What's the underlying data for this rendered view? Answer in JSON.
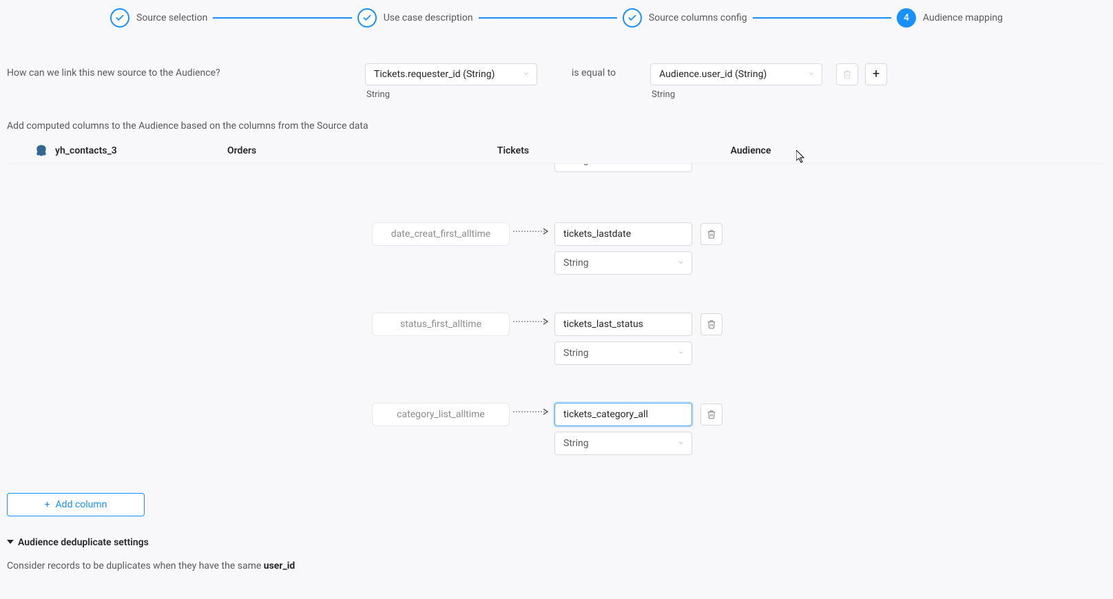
{
  "stepper": {
    "steps": [
      {
        "label": "Source selection"
      },
      {
        "label": "Use case description"
      },
      {
        "label": "Source columns config"
      },
      {
        "label": "Audience mapping",
        "num": "4"
      }
    ]
  },
  "link": {
    "question": "How can we link this new source to the Audience?",
    "left_select": "Tickets.requester_id (String)",
    "left_type": "String",
    "operator": "is equal to",
    "right_select": "Audience.user_id (String)",
    "right_type": "String"
  },
  "desc": "Add computed columns to the Audience based on the columns from the Source data",
  "columns": {
    "source_name": "yh_contacts_3",
    "header_orders": "Orders",
    "header_tickets": "Tickets",
    "header_audience": "Audience"
  },
  "mappings": [
    {
      "src": "date_creat_first_alltime",
      "dest": "tickets_lastdate",
      "type": "String"
    },
    {
      "src": "status_first_alltime",
      "dest": "tickets_last_status",
      "type": "String"
    },
    {
      "src": "category_list_alltime",
      "dest": "tickets_category_all",
      "type": "String"
    }
  ],
  "clipped_type": "String",
  "add_button": "Add column",
  "dedup": {
    "title": "Audience deduplicate settings",
    "text_prefix": "Consider records to be duplicates when they have the same ",
    "key": "user_id"
  },
  "icons": {
    "plus": "+"
  }
}
